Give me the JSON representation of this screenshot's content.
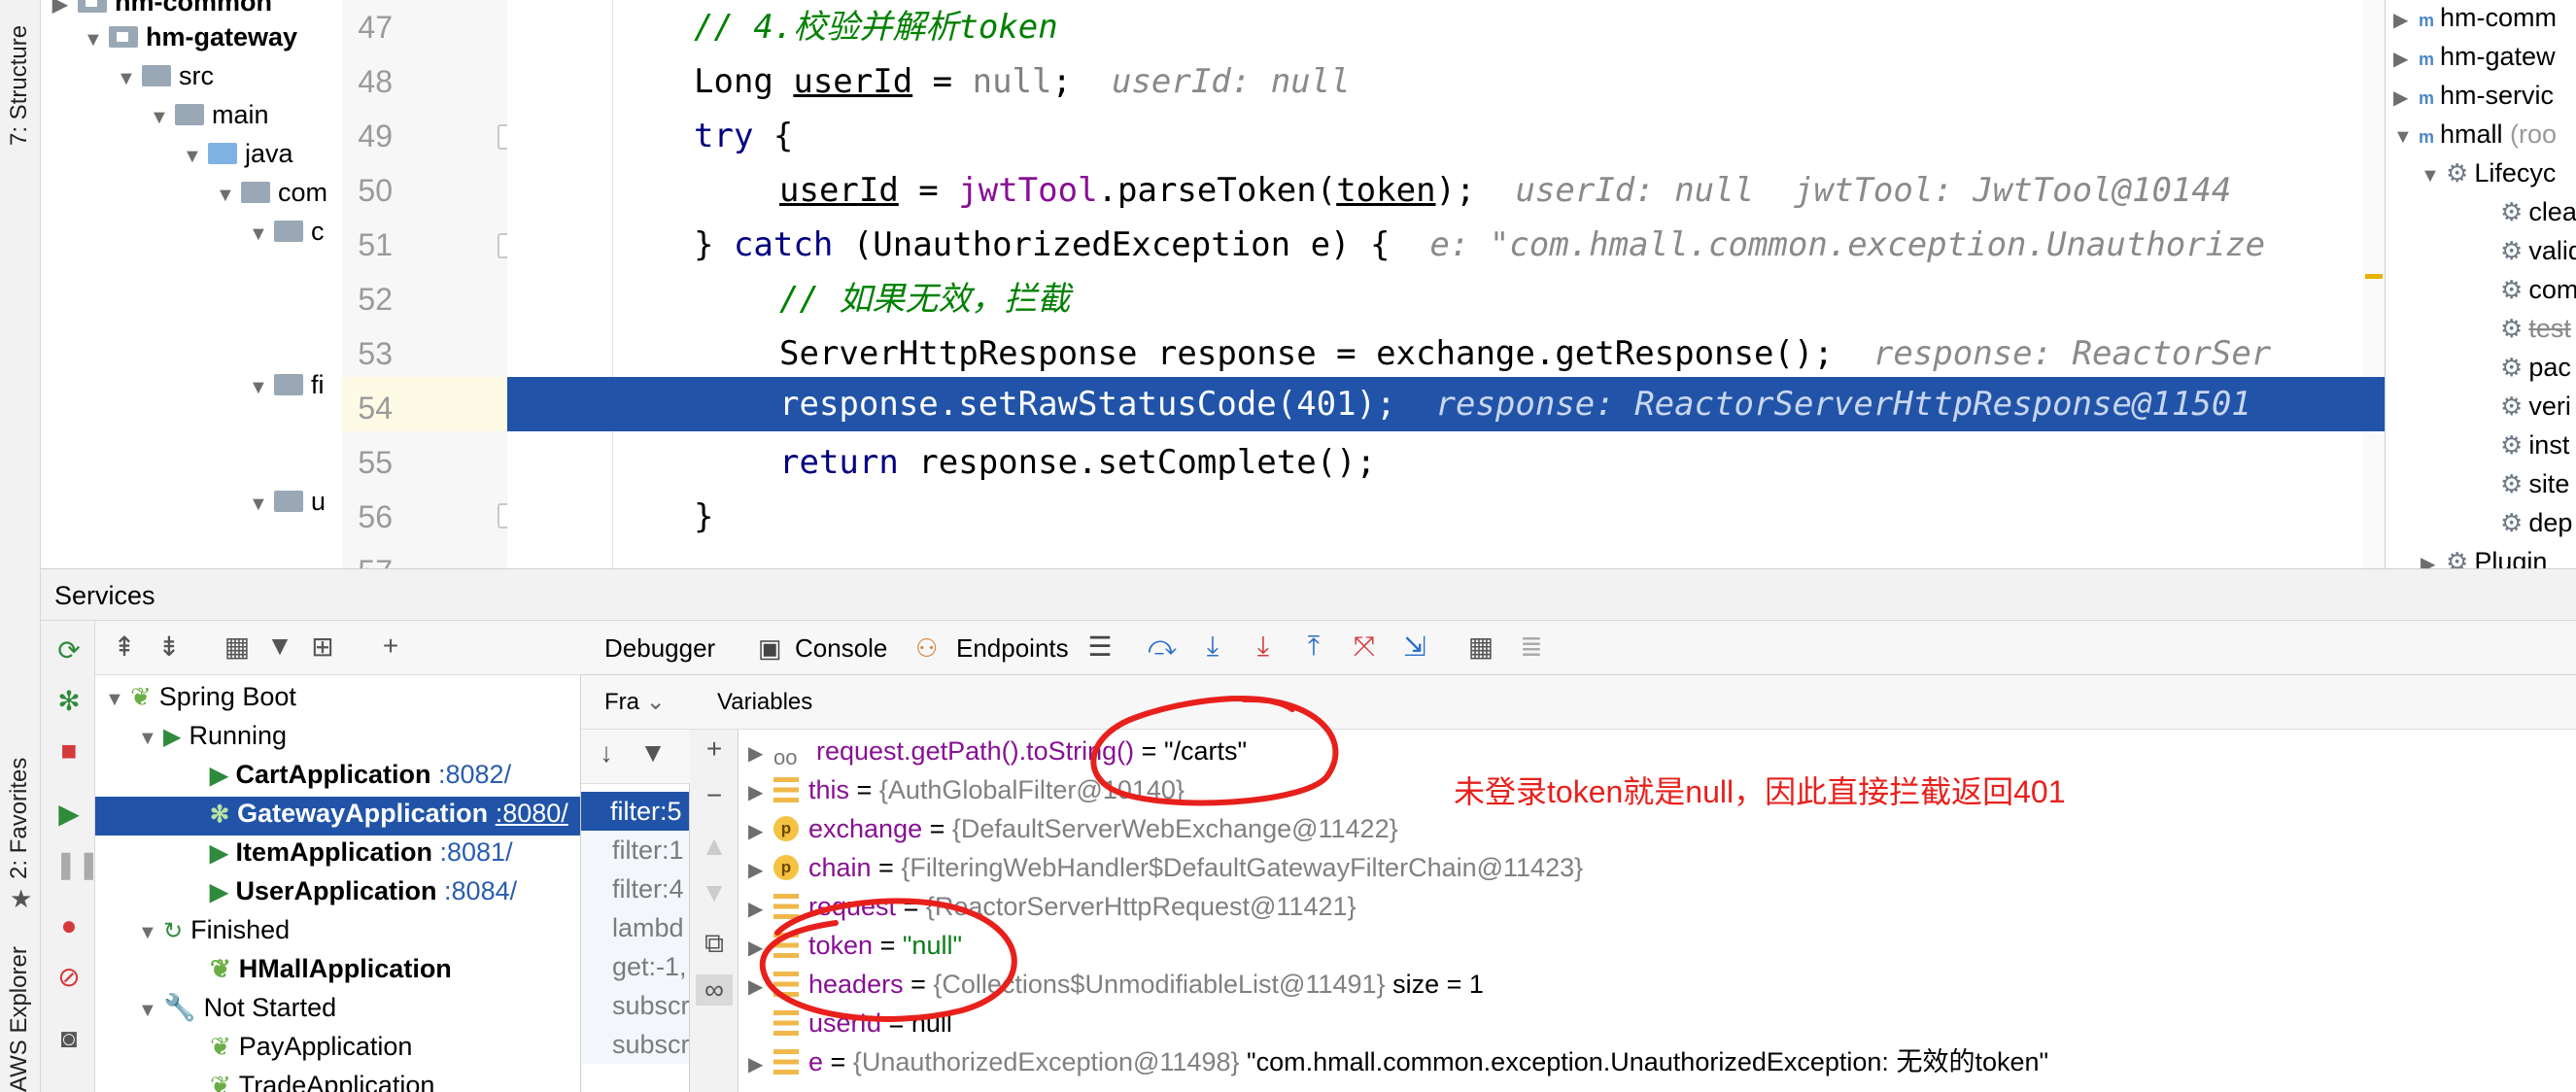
{
  "project_tree": {
    "items": [
      {
        "label": "hm-common",
        "bold": true
      },
      {
        "label": "hm-gateway",
        "bold": true
      },
      {
        "label": "src"
      },
      {
        "label": "main"
      },
      {
        "label": "java"
      },
      {
        "label": "com"
      },
      {
        "label": "c"
      },
      {
        "label": "fi"
      },
      {
        "label": "u"
      }
    ]
  },
  "left_strip": {
    "structure": "7: Structure",
    "favorites": "2: Favorites",
    "aws": "AWS Explorer"
  },
  "editor": {
    "line_numbers": [
      "47",
      "48",
      "49",
      "50",
      "51",
      "52",
      "53",
      "54",
      "55",
      "56",
      "57"
    ],
    "lines": {
      "l47_comment": "// 4.校验并解析token",
      "l48_a": "Long ",
      "l48_var": "userId",
      "l48_b": " = ",
      "l48_null": "null",
      "l48_c": ";",
      "l48_hint": "userId: null",
      "l49_kw": "try",
      "l49_b": " {",
      "l50_var": "userId",
      "l50_b": " = ",
      "l50_field": "jwtTool",
      "l50_c": ".parseToken(",
      "l50_tok": "token",
      "l50_d": ");",
      "l50_hint": "userId: null  jwtTool: JwtTool@10144",
      "l51_a": "} ",
      "l51_kw": "catch",
      "l51_b": " (UnauthorizedException e) {",
      "l51_hint": "e: \"com.hmall.common.exception.Unauthorize",
      "l52_comment": "// 如果无效，拦截",
      "l53_code": "ServerHttpResponse response = exchange.getResponse();",
      "l53_hint": "response: ReactorSer",
      "l54_code": "response.setRawStatusCode(401);",
      "l54_hint": "response: ReactorServerHttpResponse@11501",
      "l55_kw": "return",
      "l55_code": " response.setComplete();",
      "l56_code": "}"
    }
  },
  "maven": {
    "items": [
      {
        "label": "hm-comm"
      },
      {
        "label": "hm-gatew"
      },
      {
        "label": "hm-servic"
      },
      {
        "label": "hmall",
        "suffix": " (roo"
      },
      {
        "label": "Lifecyc"
      },
      {
        "label": "clea"
      },
      {
        "label": "valid"
      },
      {
        "label": "com"
      },
      {
        "label": "test"
      },
      {
        "label": "pac"
      },
      {
        "label": "veri"
      },
      {
        "label": "inst"
      },
      {
        "label": "site"
      },
      {
        "label": "dep"
      },
      {
        "label": "Plugin"
      }
    ]
  },
  "services": {
    "title": "Services",
    "tree": [
      {
        "label": "Spring Boot"
      },
      {
        "label": "Running"
      },
      {
        "label": "CartApplication",
        "port": ":8082/"
      },
      {
        "label": "GatewayApplication",
        "port": ":8080/"
      },
      {
        "label": "ItemApplication",
        "port": ":8081/"
      },
      {
        "label": "UserApplication",
        "port": ":8084/"
      },
      {
        "label": "Finished"
      },
      {
        "label": "HMallApplication"
      },
      {
        "label": "Not Started"
      },
      {
        "label": "PayApplication"
      },
      {
        "label": "TradeApplication"
      }
    ]
  },
  "debugger": {
    "tabs": {
      "debugger": "Debugger",
      "console": "Console",
      "endpoints": "Endpoints"
    },
    "frames_label": "Fra",
    "variables_label": "Variables",
    "frames": [
      "filter:5",
      "filter:1",
      "filter:4",
      "lambd",
      "get:-1,",
      "subscr",
      "subscr"
    ],
    "variables": [
      {
        "name": "request.getPath().toString()",
        "value": "\"/carts\""
      },
      {
        "name": "this",
        "value": "{AuthGlobalFilter@10140}"
      },
      {
        "name": "exchange",
        "value": "{DefaultServerWebExchange@11422}"
      },
      {
        "name": "chain",
        "value": "{FilteringWebHandler$DefaultGatewayFilterChain@11423}"
      },
      {
        "name": "request",
        "value": "{ReactorServerHttpRequest@11421}"
      },
      {
        "name": "token",
        "value": "\"null\""
      },
      {
        "name": "headers",
        "value": "{Collections$UnmodifiableList@11491}",
        "extra": "size = 1"
      },
      {
        "name": "userId",
        "value": "null"
      },
      {
        "name": "e",
        "value": "{UnauthorizedException@11498}",
        "extra": "\"com.hmall.common.exception.UnauthorizedException: 无效的token\""
      }
    ],
    "eq": " = "
  },
  "annotation": {
    "text": "未登录token就是null，因此直接拦截返回401",
    "color": "#e8201c"
  },
  "colors": {
    "selection": "#2154a8",
    "keyword": "#000080",
    "comment": "#008000",
    "field": "#871094"
  }
}
